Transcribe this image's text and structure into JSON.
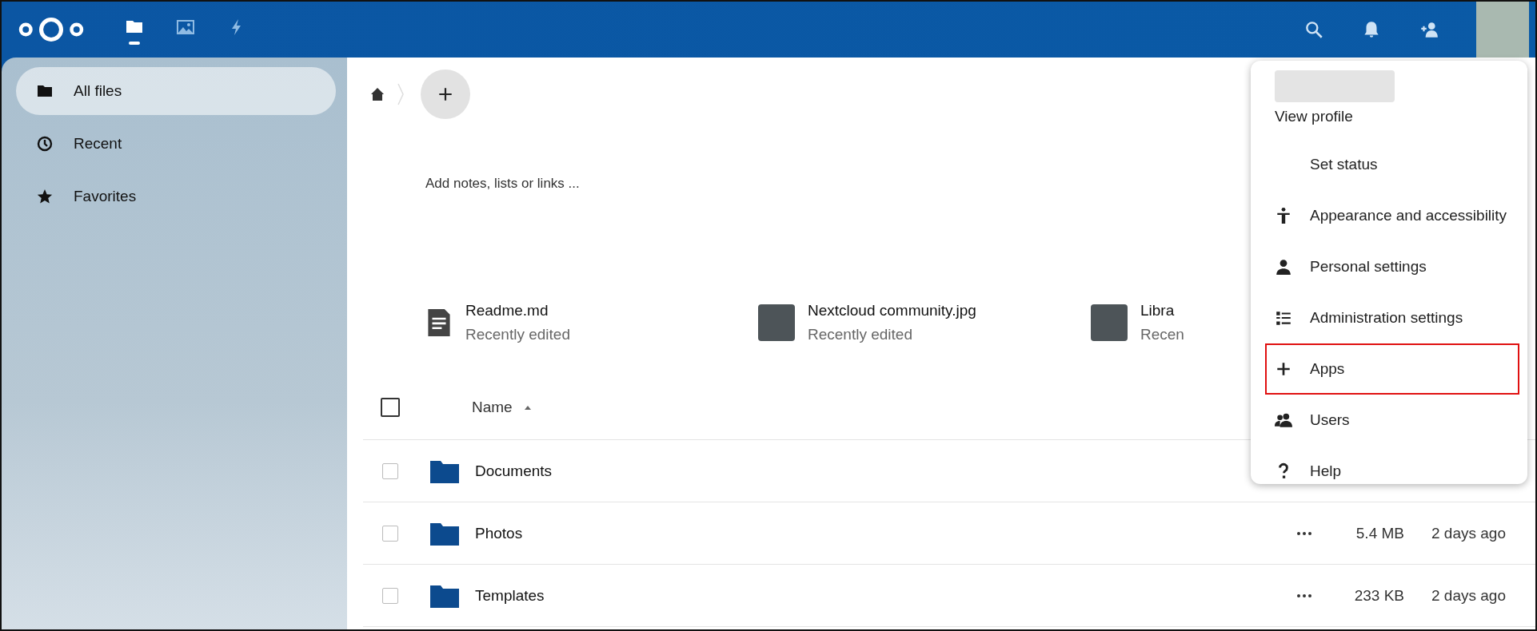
{
  "header": {
    "apps": [
      {
        "kind": "files",
        "selected": true
      },
      {
        "kind": "photos",
        "selected": false
      },
      {
        "kind": "activity",
        "selected": false
      }
    ]
  },
  "sidebar": {
    "items": [
      {
        "kind": "folder",
        "label": "All files",
        "selected": true
      },
      {
        "kind": "clock",
        "label": "Recent",
        "selected": false
      },
      {
        "kind": "star",
        "label": "Favorites",
        "selected": false
      }
    ]
  },
  "notes": {
    "placeholder": "Add notes, lists or links ..."
  },
  "recent_files": [
    {
      "kind": "document",
      "name": "Readme.md",
      "note": "Recently edited"
    },
    {
      "kind": "image",
      "name": "Nextcloud community.jpg",
      "note": "Recently edited"
    },
    {
      "kind": "image",
      "name": "Libra",
      "note": "Recen"
    }
  ],
  "table": {
    "columns": [
      "Name"
    ],
    "select_all": {
      "checked": false
    },
    "rows": [
      {
        "name": "Documents",
        "checked": false
      },
      {
        "name": "Photos",
        "checked": false,
        "size": "5.4 MB",
        "modified": "2 days ago"
      },
      {
        "name": "Templates",
        "checked": false,
        "size": "233 KB",
        "modified": "2 days ago"
      }
    ]
  },
  "user_menu": {
    "items": [
      {
        "kind": "profile",
        "label": "View profile",
        "highlighted": false
      },
      {
        "kind": "status",
        "label": "Set status",
        "highlighted": false
      },
      {
        "kind": "accessibility",
        "label": "Appearance and accessibility",
        "highlighted": false
      },
      {
        "kind": "person",
        "label": "Personal settings",
        "highlighted": false
      },
      {
        "kind": "admin",
        "label": "Administration settings",
        "highlighted": false
      },
      {
        "kind": "apps",
        "label": "Apps",
        "highlighted": true
      },
      {
        "kind": "users",
        "label": "Users",
        "highlighted": false
      },
      {
        "kind": "help",
        "label": "Help",
        "highlighted": false
      }
    ]
  }
}
